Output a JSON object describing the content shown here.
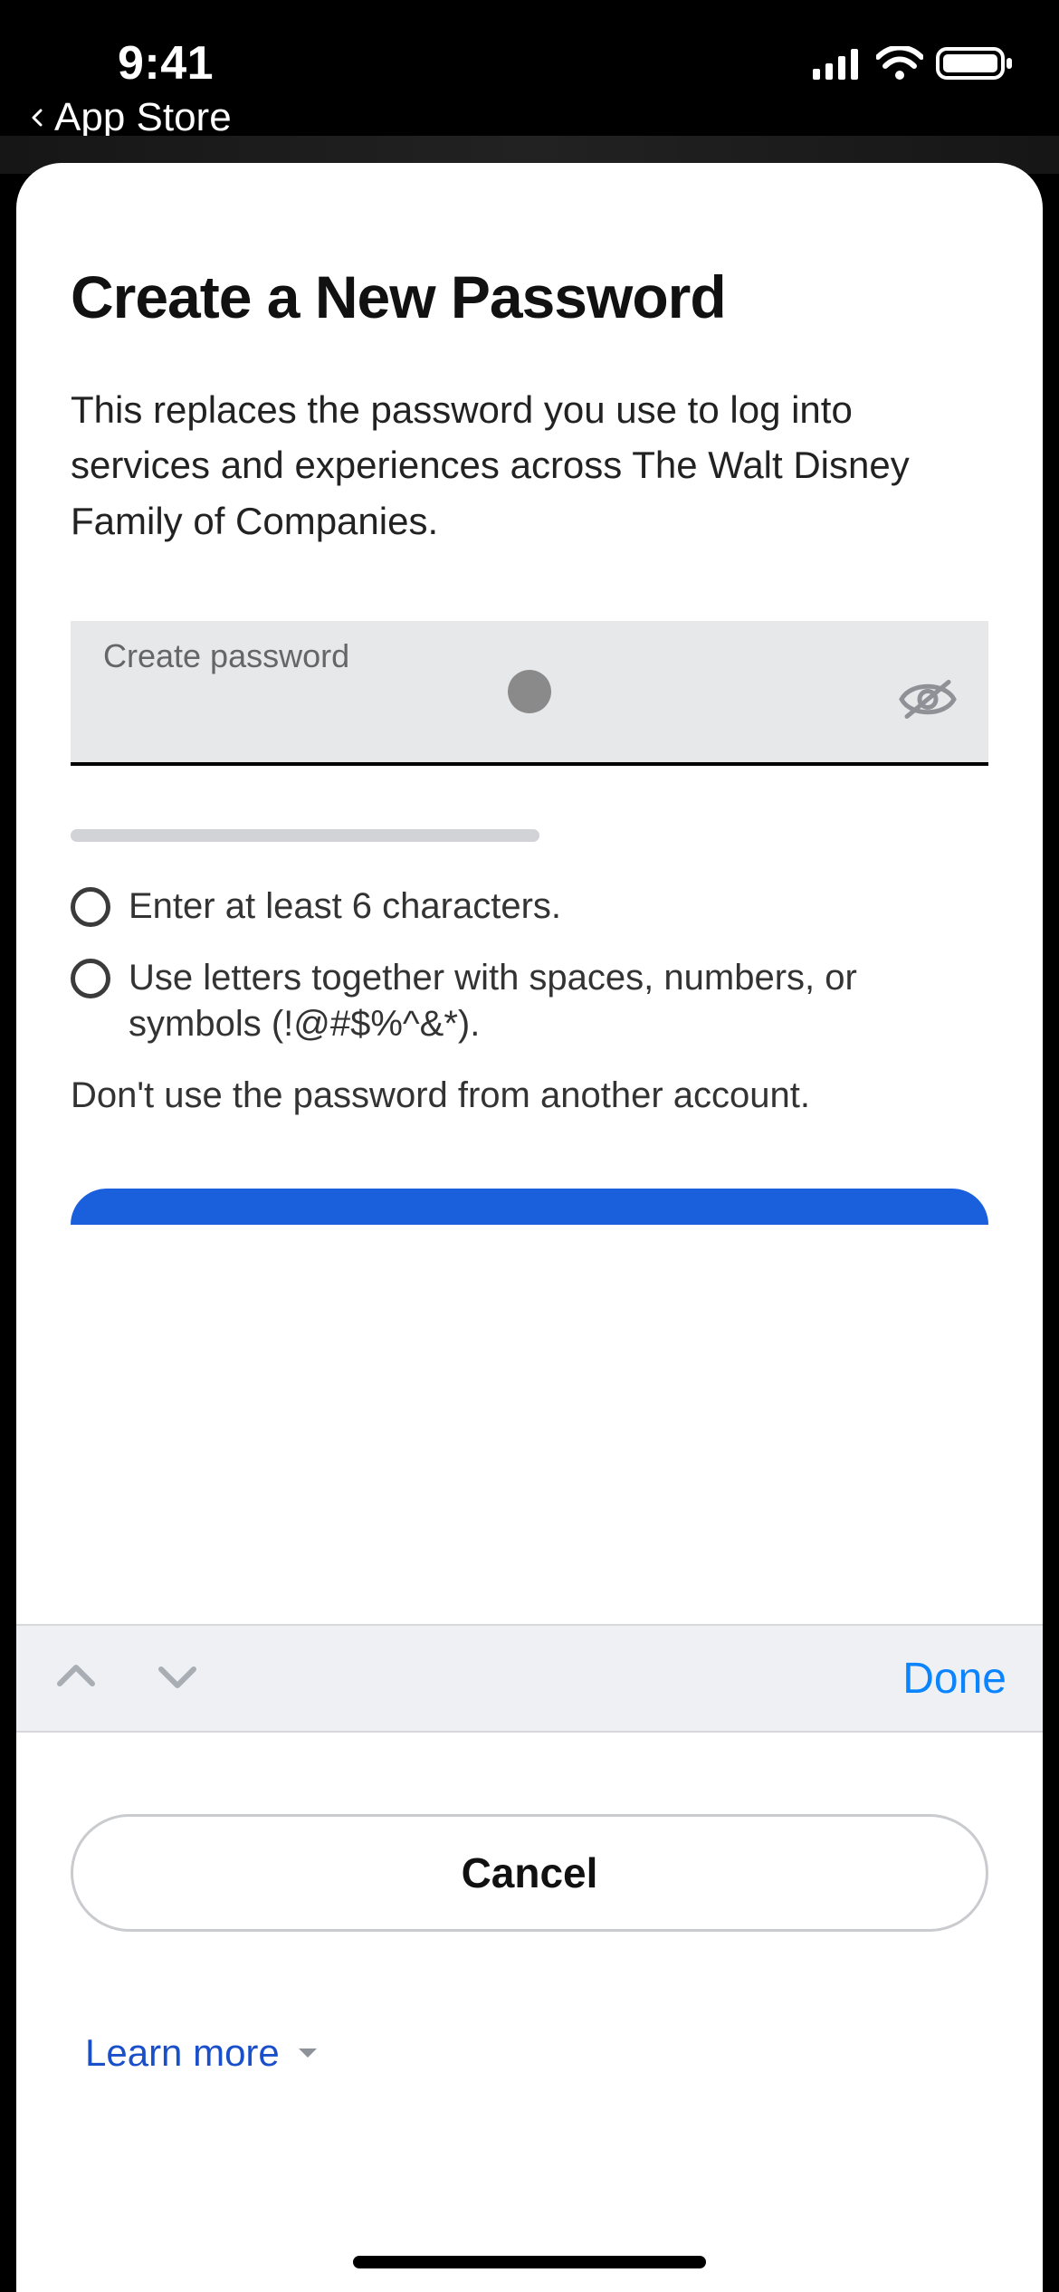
{
  "status": {
    "time": "9:41",
    "back_label": "App Store"
  },
  "page": {
    "title": "Create a New Password",
    "subtitle": "This replaces the password you use to log into services and experiences across The Walt Disney Family of Companies."
  },
  "input": {
    "placeholder": "Create password",
    "value": ""
  },
  "requirements": {
    "r1": "Enter at least 6 characters.",
    "r2": "Use letters together with spaces, numbers, or symbols (!@#$%^&*)."
  },
  "note": "Don't use the password from another account.",
  "buttons": {
    "cancel": "Cancel",
    "done": "Done",
    "learn_more": "Learn more"
  }
}
